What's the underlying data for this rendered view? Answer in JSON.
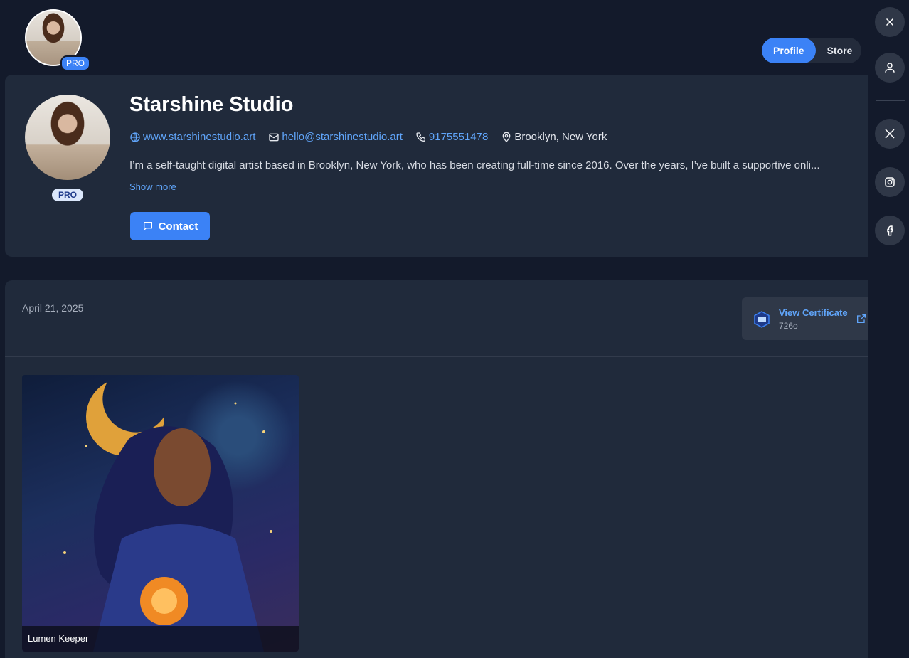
{
  "header": {
    "pro_badge": "PRO",
    "tabs": [
      {
        "label": "Profile",
        "active": true
      },
      {
        "label": "Store",
        "active": false
      }
    ]
  },
  "profile": {
    "name": "Starshine Studio",
    "pro_badge": "PRO",
    "website": "www.starshinestudio.art",
    "email": "hello@starshinestudio.art",
    "phone": "9175551478",
    "location": "Brooklyn, New York",
    "bio": "I’m a self-taught digital artist based in Brooklyn, New York, who has been creating full-time since 2016. Over the years, I’ve built a supportive onli...",
    "show_more": "Show more",
    "contact_button": "Contact"
  },
  "rail": {
    "icons": [
      "close-icon",
      "user-icon",
      "x-twitter-icon",
      "instagram-icon",
      "facebook-icon"
    ]
  },
  "post": {
    "date": "April 21, 2025",
    "certificate": {
      "title": "View Certificate",
      "id": "726o"
    },
    "artwork": {
      "caption": "Lumen Keeper"
    }
  },
  "colors": {
    "accent": "#3b82f6",
    "link": "#60a5fa",
    "background": "#131a2b",
    "card": "#202a3b"
  }
}
